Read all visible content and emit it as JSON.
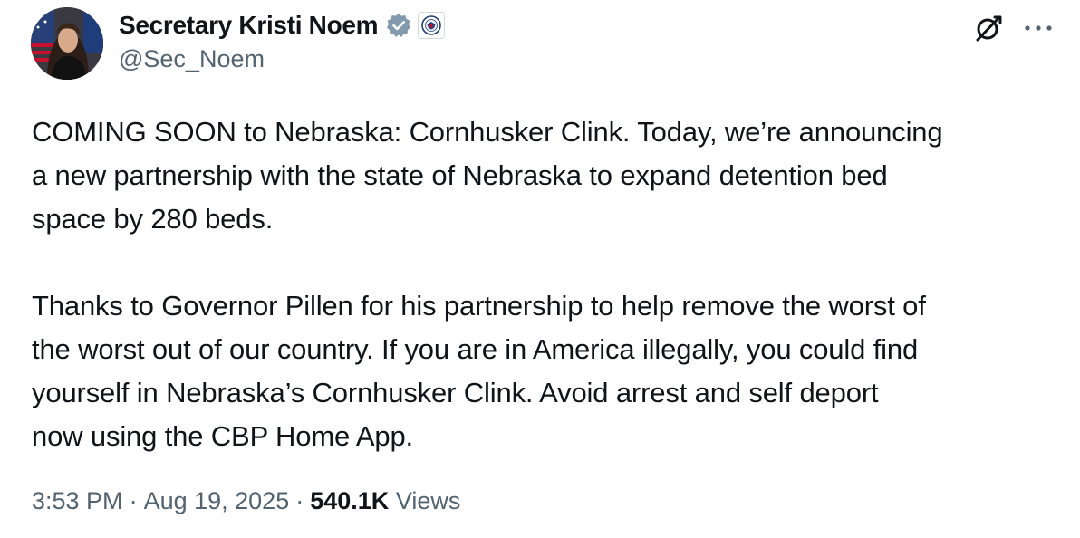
{
  "author": {
    "display_name": "Secretary Kristi Noem",
    "handle": "@Sec_Noem",
    "verified_badge_icon": "verified-check-icon",
    "affiliate_badge_icon": "dhs-seal-icon",
    "verified_color": "#829aab"
  },
  "actions": {
    "grok_icon": "grok-icon",
    "more_icon": "more-horizontal-icon"
  },
  "tweet": {
    "paragraph_1": "COMING SOON to Nebraska: Cornhusker Clink. Today, we’re announcing\na new partnership with the state of Nebraska to expand detention bed\nspace by 280 beds.",
    "paragraph_2": "Thanks to Governor Pillen for his partnership to help remove the worst of\nthe worst out of our country. If you are in America illegally, you could find\nyourself in Nebraska’s Cornhusker Clink. Avoid arrest and self deport\nnow using the CBP Home App."
  },
  "meta": {
    "time": "3:53 PM",
    "separator": "·",
    "date": "Aug 19, 2025",
    "views_count": "540.1K",
    "views_label": "Views"
  },
  "colors": {
    "text_primary": "#0f1419",
    "text_secondary": "#536471",
    "background": "#ffffff"
  }
}
